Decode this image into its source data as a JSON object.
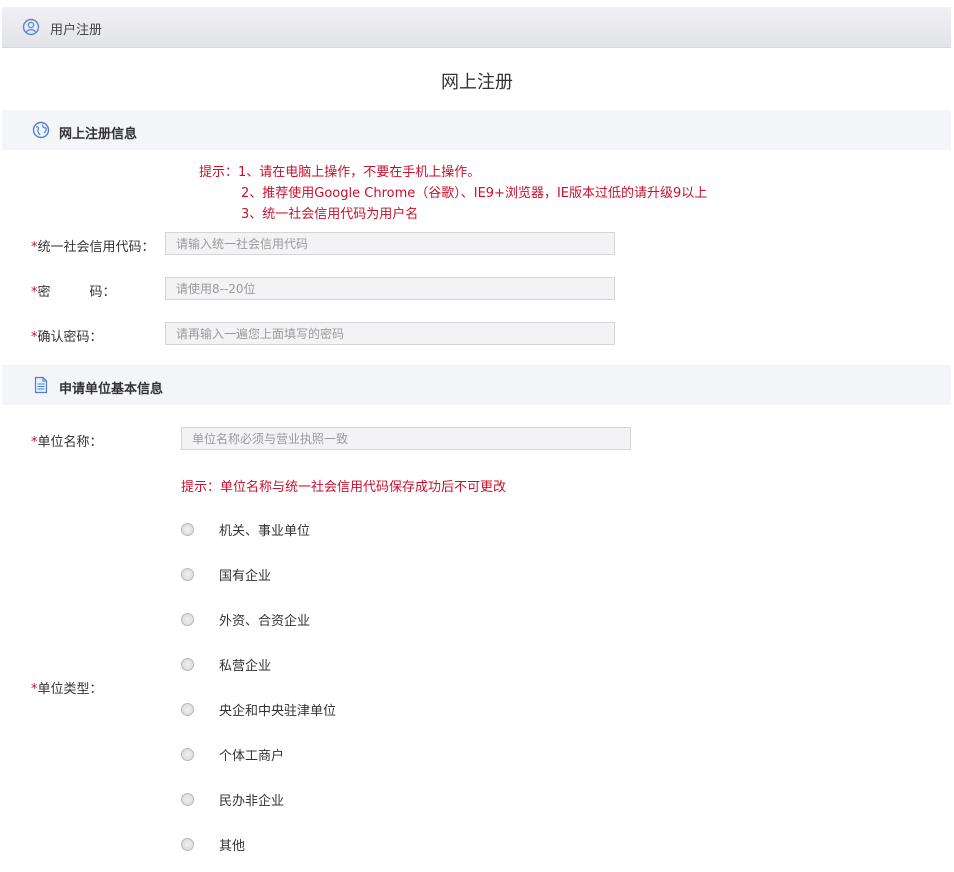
{
  "header": {
    "title": "用户注册",
    "icon": "user-circle-icon"
  },
  "page_title": "网上注册",
  "section1": {
    "title": "网上注册信息",
    "icon": "globe-icon"
  },
  "notice": {
    "line1": "提示：1、请在电脑上操作，不要在手机上操作。",
    "line2": "2、推荐使用Google Chrome（谷歌）、IE9+浏览器，IE版本过低的请升级9以上",
    "line3": "3、统一社会信用代码为用户名"
  },
  "fields": {
    "credit_code": {
      "label": "统一社会信用代码：",
      "placeholder": "请输入统一社会信用代码",
      "value": ""
    },
    "password": {
      "label_a": "密",
      "label_b": "码：",
      "placeholder": "请使用8--20位",
      "value": ""
    },
    "confirm": {
      "label": "确认密码：",
      "placeholder": "请再输入一遍您上面填写的密码",
      "value": ""
    }
  },
  "section2": {
    "title": "申请单位基本信息",
    "icon": "document-icon"
  },
  "unit_name": {
    "label": "单位名称：",
    "placeholder": "单位名称必须与营业执照一致",
    "value": ""
  },
  "unit_notice": "提示：单位名称与统一社会信用代码保存成功后不可更改",
  "unit_type": {
    "label": "单位类型：",
    "options": [
      "机关、事业单位",
      "国有企业",
      "外资、合资企业",
      "私营企业",
      "央企和中央驻津单位",
      "个体工商户",
      "民办非企业",
      "其他"
    ],
    "selected": null
  },
  "colors": {
    "required": "#c8102e",
    "accent": "#2f6fd6"
  }
}
